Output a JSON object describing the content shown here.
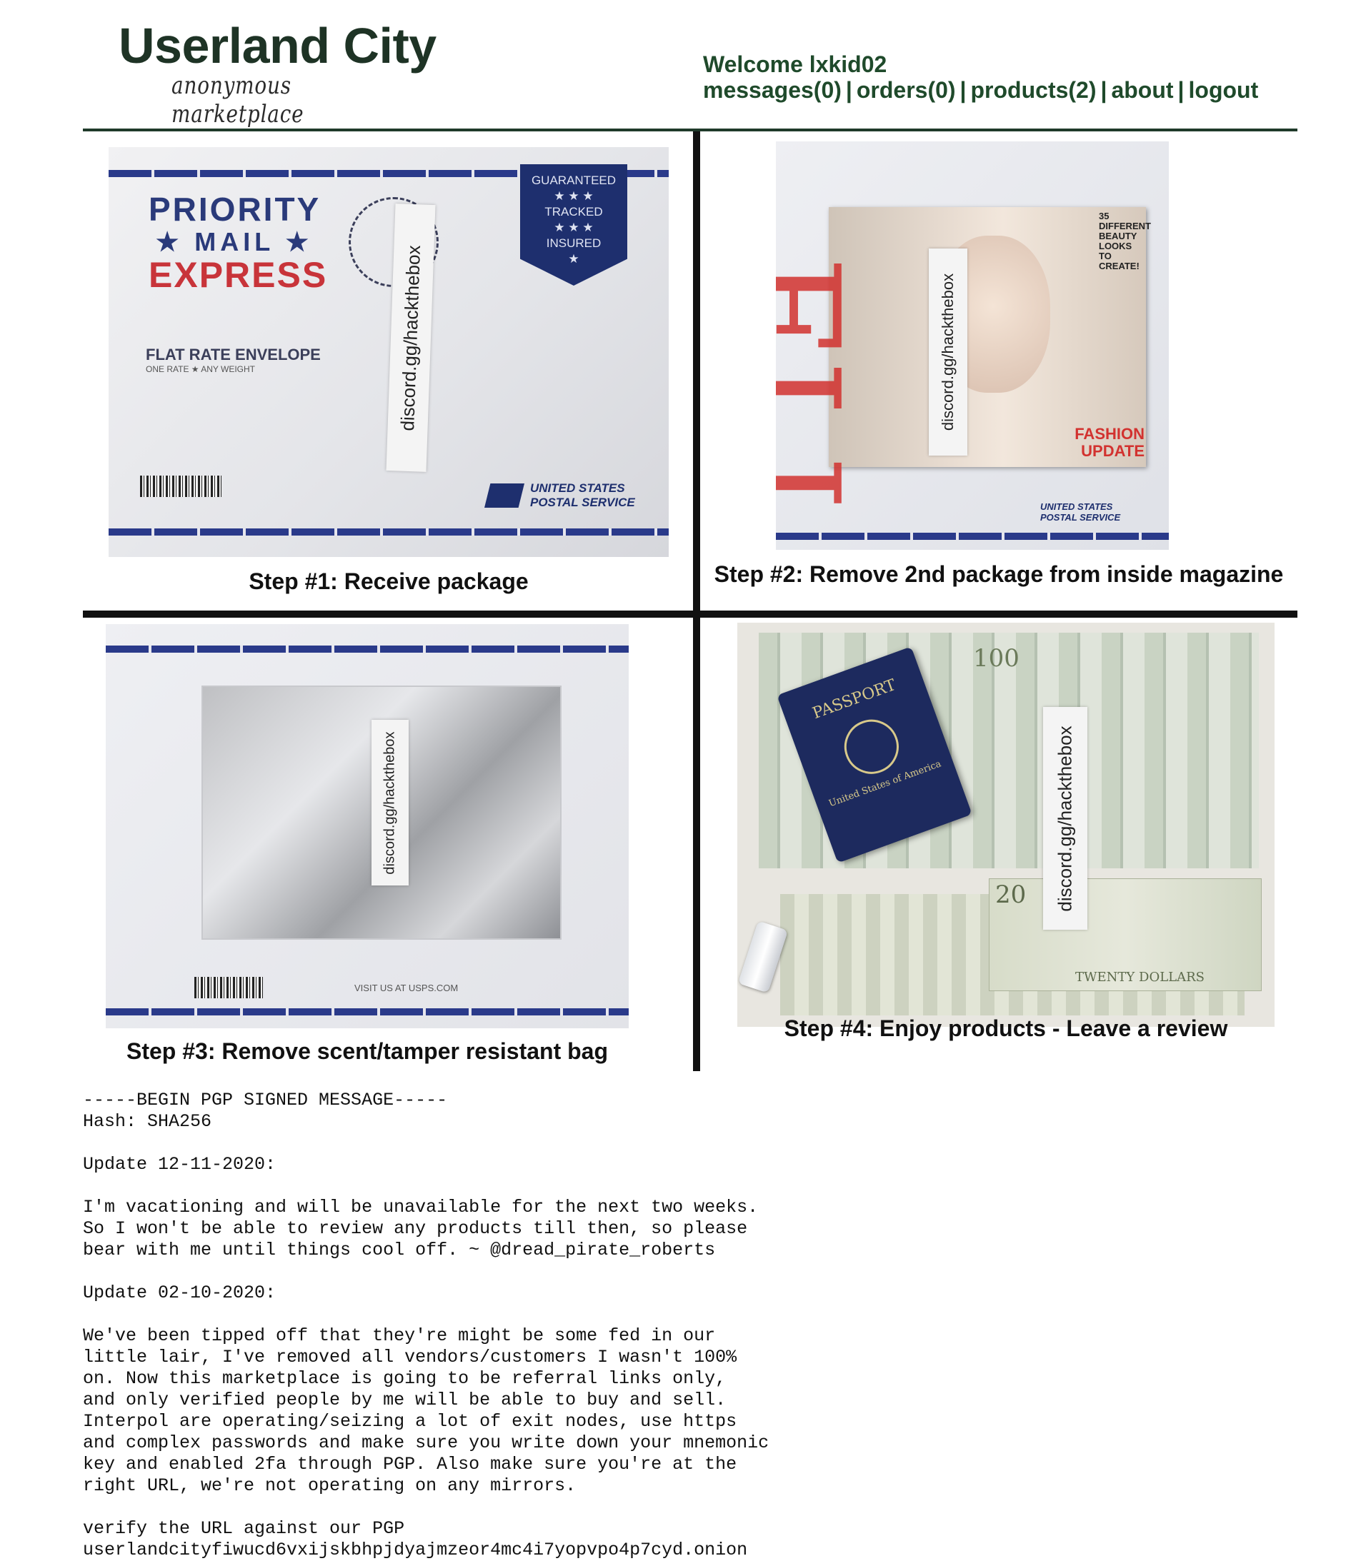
{
  "brand": {
    "title": "Userland City",
    "subtitle": "anonymous marketplace"
  },
  "user": {
    "welcome": "Welcome lxkid02",
    "nav": [
      "messages(0)",
      "orders(0)",
      "products(2)",
      "about",
      "logout"
    ]
  },
  "steps": [
    {
      "caption": "Step #1: Receive package",
      "sticker": "discord.gg/hackthebox"
    },
    {
      "caption": "Step #2: Remove 2nd package from inside magazine",
      "sticker": "discord.gg/hackthebox"
    },
    {
      "caption": "Step #3: Remove scent/tamper resistant bag",
      "sticker": "discord.gg/hackthebox"
    },
    {
      "caption": "Step #4: Enjoy products - Leave a review",
      "sticker": "discord.gg/hackthebox"
    }
  ],
  "photo_text": {
    "envelope_brand": [
      "PRIORITY",
      "★ MAIL ★",
      "EXPRESS"
    ],
    "badge": [
      "GUARANTEED",
      "★ ★ ★",
      "TRACKED",
      "★ ★ ★",
      "INSURED",
      "★"
    ],
    "flat_rate": "FLAT RATE ENVELOPE",
    "flat_rate_sub": "ONE RATE ★ ANY WEIGHT",
    "usps": "UNITED STATES POSTAL SERVICE",
    "magazine_title": "ELLE",
    "magazine_cover": [
      "35 DIFFERENT BEAUTY LOOKS TO CREATE!",
      "FASHION UPDATE"
    ],
    "passport": "PASSPORT",
    "passport_sub": "United States of America",
    "usps_visit": "VISIT US AT USPS.COM",
    "bill_100": "100",
    "bill_20": "20",
    "bill_20_words": "TWENTY DOLLARS"
  },
  "pgp": {
    "text": "-----BEGIN PGP SIGNED MESSAGE-----\nHash: SHA256\n\nUpdate 12-11-2020:\n\nI'm vacationing and will be unavailable for the next two weeks.\nSo I won't be able to review any products till then, so please\nbear with me until things cool off. ~ @dread_pirate_roberts\n\nUpdate 02-10-2020:\n\nWe've been tipped off that they're might be some fed in our\nlittle lair, I've removed all vendors/customers I wasn't 100%\non. Now this marketplace is going to be referral links only,\nand only verified people by me will be able to buy and sell.\nInterpol are operating/seizing a lot of exit nodes, use https\nand complex passwords and make sure you write down your mnemonic\nkey and enabled 2fa through PGP. Also make sure you're at the\nright URL, we're not operating on any mirrors.\n\nverify the URL against our PGP\nuserlandcityfiwucd6vxijskbhpjdyajmzeor4mc4i7yopvpo4p7cyd.onion"
  },
  "colors": {
    "brand_green": "#1e3325",
    "nav_green": "#1f4a2b",
    "usps_blue": "#2a3a8a",
    "express_red": "#c8343a"
  }
}
